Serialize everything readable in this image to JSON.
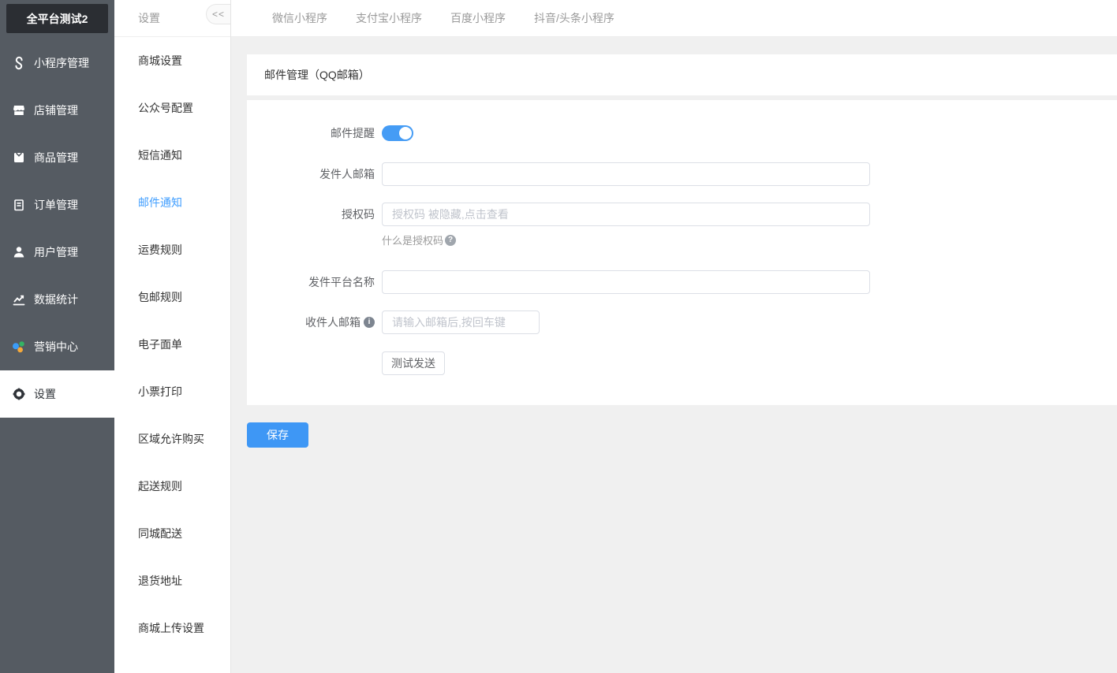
{
  "app": {
    "logo": "全平台测试2"
  },
  "sidebar": {
    "items": [
      {
        "label": "小程序管理",
        "icon": "miniprogram-icon"
      },
      {
        "label": "店铺管理",
        "icon": "shop-icon"
      },
      {
        "label": "商品管理",
        "icon": "product-icon"
      },
      {
        "label": "订单管理",
        "icon": "order-icon"
      },
      {
        "label": "用户管理",
        "icon": "user-icon"
      },
      {
        "label": "数据统计",
        "icon": "stats-icon"
      },
      {
        "label": "营销中心",
        "icon": "marketing-icon"
      },
      {
        "label": "设置",
        "icon": "gear-icon"
      }
    ],
    "active": "设置"
  },
  "submenu": {
    "title": "设置",
    "collapse_label": "<<",
    "items": [
      "商城设置",
      "公众号配置",
      "短信通知",
      "邮件通知",
      "运费规则",
      "包邮规则",
      "电子面单",
      "小票打印",
      "区域允许购买",
      "起送规则",
      "同城配送",
      "退货地址",
      "商城上传设置"
    ],
    "active": "邮件通知"
  },
  "tabs": [
    "微信小程序",
    "支付宝小程序",
    "百度小程序",
    "抖音/头条小程序"
  ],
  "main": {
    "card_title": "邮件管理（QQ邮箱）",
    "form": {
      "toggle_label": "邮件提醒",
      "toggle_on": true,
      "sender_label": "发件人邮箱",
      "sender_value": "",
      "authcode_label": "授权码",
      "authcode_placeholder": "授权码 被隐藏,点击查看",
      "authcode_help": "什么是授权码",
      "question_glyph": "?",
      "platform_label": "发件平台名称",
      "platform_value": "",
      "recipient_label": "收件人邮箱",
      "info_glyph": "i",
      "recipient_placeholder": "请输入邮箱后,按回车键",
      "test_button": "测试发送"
    },
    "save_button": "保存"
  },
  "colors": {
    "accent": "#409eff",
    "sidebar_bg": "#555b62",
    "logo_bg": "#2b2e33",
    "content_bg": "#f0f0f0",
    "toggle_on": "#459cf5",
    "save_button": "#3e97f5"
  }
}
